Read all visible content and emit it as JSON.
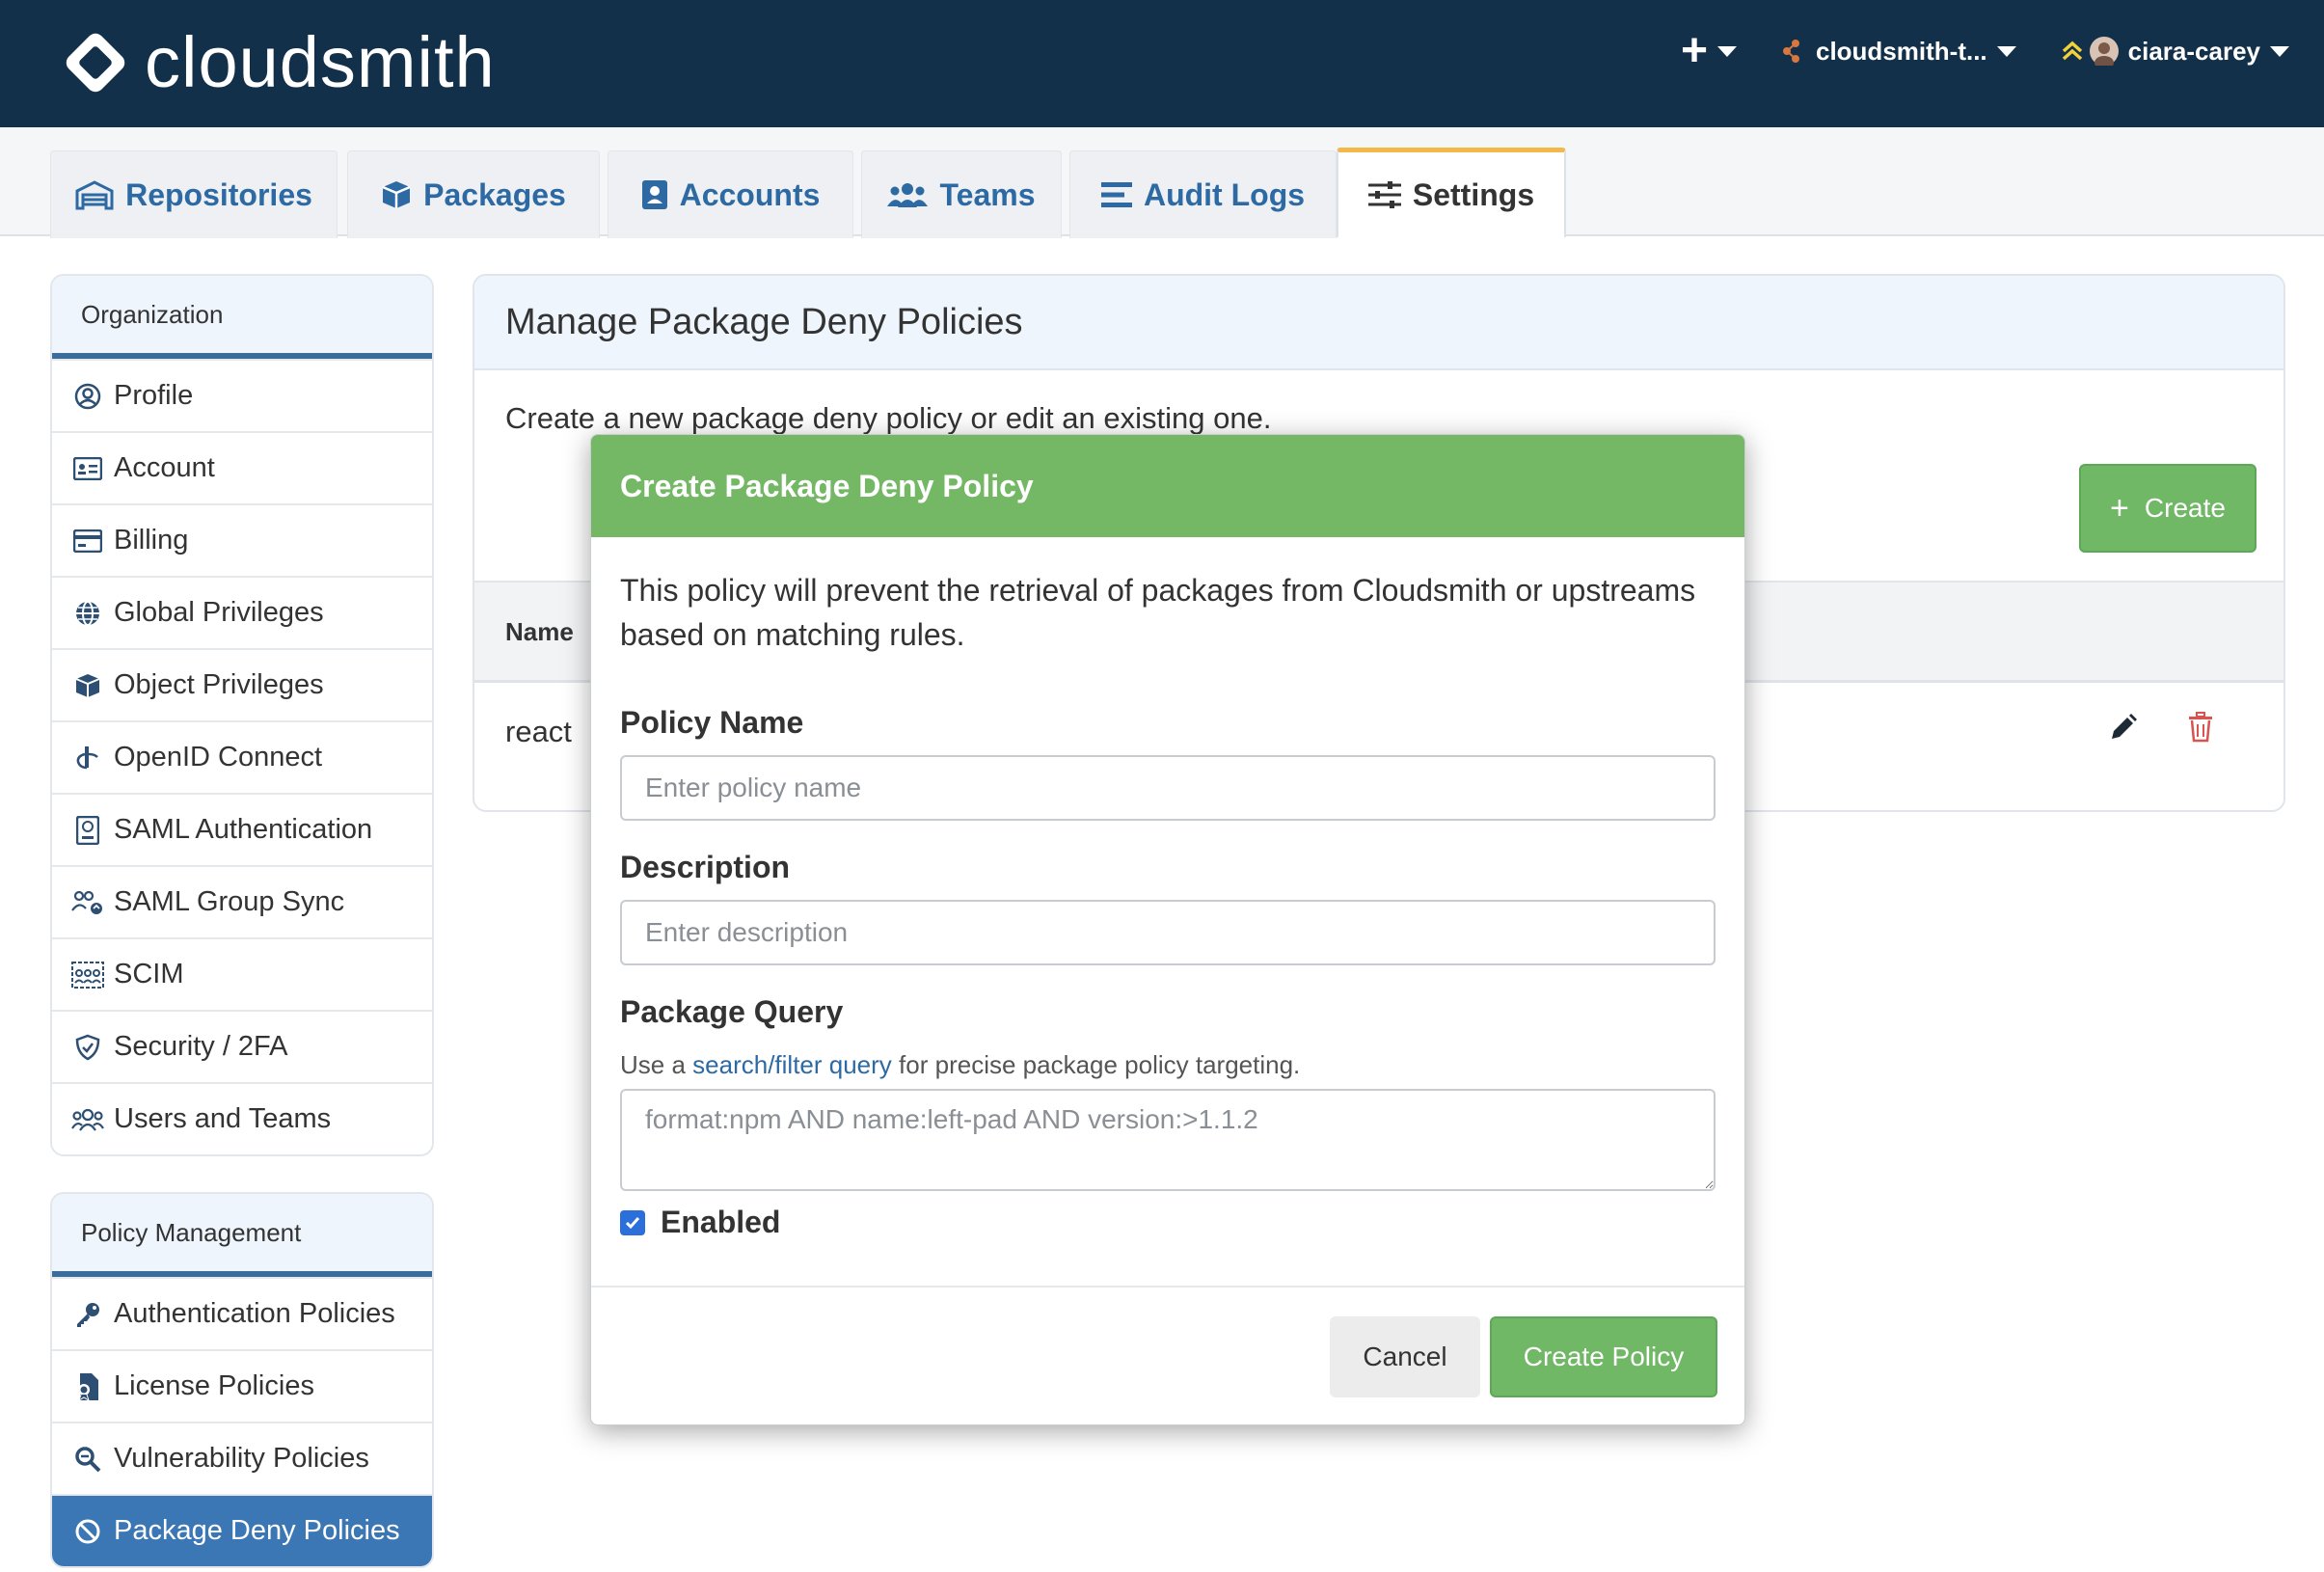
{
  "header": {
    "logo_text": "cloudsmith",
    "workspace_label": "cloudsmith-t...",
    "user_label": "ciara-carey",
    "brand_color": "#13304a"
  },
  "tabs": [
    {
      "label": "Repositories",
      "icon": "warehouse-icon"
    },
    {
      "label": "Packages",
      "icon": "package-icon"
    },
    {
      "label": "Accounts",
      "icon": "contact-card-icon"
    },
    {
      "label": "Teams",
      "icon": "users-icon"
    },
    {
      "label": "Audit Logs",
      "icon": "list-icon"
    },
    {
      "label": "Settings",
      "icon": "sliders-icon",
      "active": true
    }
  ],
  "sidebar": {
    "organization": {
      "title": "Organization",
      "items": [
        {
          "label": "Profile",
          "icon": "user-circle-icon"
        },
        {
          "label": "Account",
          "icon": "id-card-icon"
        },
        {
          "label": "Billing",
          "icon": "credit-card-icon"
        },
        {
          "label": "Global Privileges",
          "icon": "globe-icon"
        },
        {
          "label": "Object Privileges",
          "icon": "cube-icon"
        },
        {
          "label": "OpenID Connect",
          "icon": "openid-icon"
        },
        {
          "label": "SAML Authentication",
          "icon": "saml-icon"
        },
        {
          "label": "SAML Group Sync",
          "icon": "group-sync-icon"
        },
        {
          "label": "SCIM",
          "icon": "scim-icon"
        },
        {
          "label": "Security / 2FA",
          "icon": "shield-icon"
        },
        {
          "label": "Users and Teams",
          "icon": "users-icon"
        }
      ]
    },
    "policy": {
      "title": "Policy Management",
      "items": [
        {
          "label": "Authentication Policies",
          "icon": "key-icon"
        },
        {
          "label": "License Policies",
          "icon": "license-icon"
        },
        {
          "label": "Vulnerability Policies",
          "icon": "magnifier-icon"
        },
        {
          "label": "Package Deny Policies",
          "icon": "ban-icon",
          "active": true
        }
      ]
    }
  },
  "main": {
    "title": "Manage Package Deny Policies",
    "intro": "Create a new package deny policy or edit an existing one.",
    "create_button": "Create",
    "table": {
      "columns": [
        "Name"
      ],
      "rows": [
        {
          "name": "react"
        }
      ]
    }
  },
  "modal": {
    "title": "Create Package Deny Policy",
    "description": "This policy will prevent the retrieval of packages from Cloudsmith or upstreams based on matching rules.",
    "policy_name": {
      "label": "Policy Name",
      "placeholder": "Enter policy name",
      "value": ""
    },
    "description_field": {
      "label": "Description",
      "placeholder": "Enter description",
      "value": ""
    },
    "package_query": {
      "label": "Package Query",
      "help_prefix": "Use a",
      "help_link": "search/filter query",
      "help_suffix": "for precise package policy targeting.",
      "placeholder": "format:npm AND name:left-pad AND version:>1.1.2",
      "value": ""
    },
    "enabled": {
      "label": "Enabled",
      "checked": true
    },
    "cancel_button": "Cancel",
    "submit_button": "Create Policy",
    "accent_color": "#74b866"
  }
}
